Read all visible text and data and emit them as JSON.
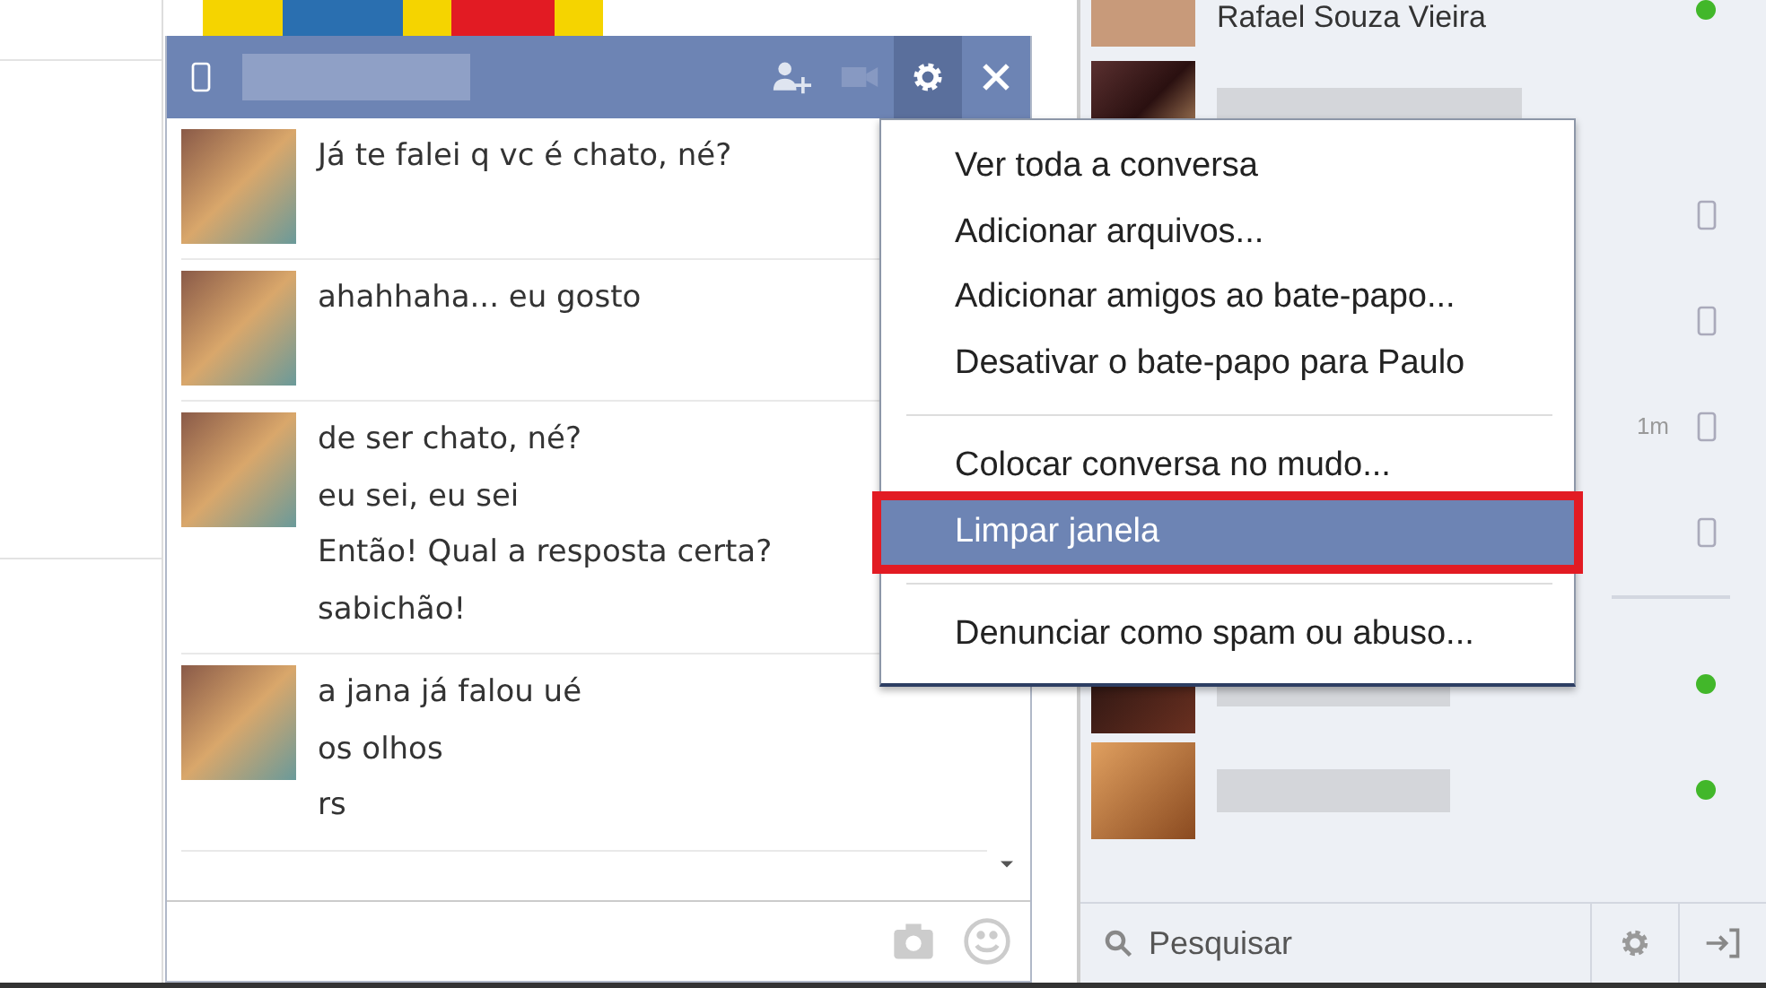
{
  "chat": {
    "messages": [
      {
        "lines": [
          "Já te falei q vc é chato, né?"
        ]
      },
      {
        "lines": [
          "ahahhaha... eu gosto"
        ]
      },
      {
        "lines": [
          "de ser chato, né?",
          "eu sei, eu sei",
          "Então! Qual a resposta certa?",
          "sabichão!"
        ]
      },
      {
        "lines": [
          "a jana já falou ué",
          "os olhos",
          "rs"
        ]
      }
    ]
  },
  "menu": {
    "groups": [
      [
        {
          "label": "Ver toda a conversa",
          "selected": false
        },
        {
          "label": "Adicionar arquivos...",
          "selected": false
        },
        {
          "label": "Adicionar amigos ao bate-papo...",
          "selected": false
        },
        {
          "label": "Desativar o bate-papo para Paulo",
          "selected": false
        }
      ],
      [
        {
          "label": "Colocar conversa no mudo...",
          "selected": false
        },
        {
          "label": "Limpar janela",
          "selected": true
        }
      ],
      [
        {
          "label": "Denunciar como spam ou abuso...",
          "selected": false
        }
      ]
    ]
  },
  "sidebar": {
    "contacts": [
      {
        "name": "Rafael Souza Vieira",
        "online": true,
        "mobile": false
      },
      {
        "online": false,
        "mobile": false
      },
      {
        "online": false,
        "mobile": true
      },
      {
        "online": false,
        "mobile": true
      },
      {
        "online": false,
        "mobile": true,
        "time": "1m"
      },
      {
        "online": false,
        "mobile": true
      }
    ],
    "online": [
      {
        "online": true,
        "mobile": false
      },
      {
        "online": true,
        "mobile": false
      }
    ],
    "search": {
      "placeholder": "Pesquisar"
    }
  }
}
